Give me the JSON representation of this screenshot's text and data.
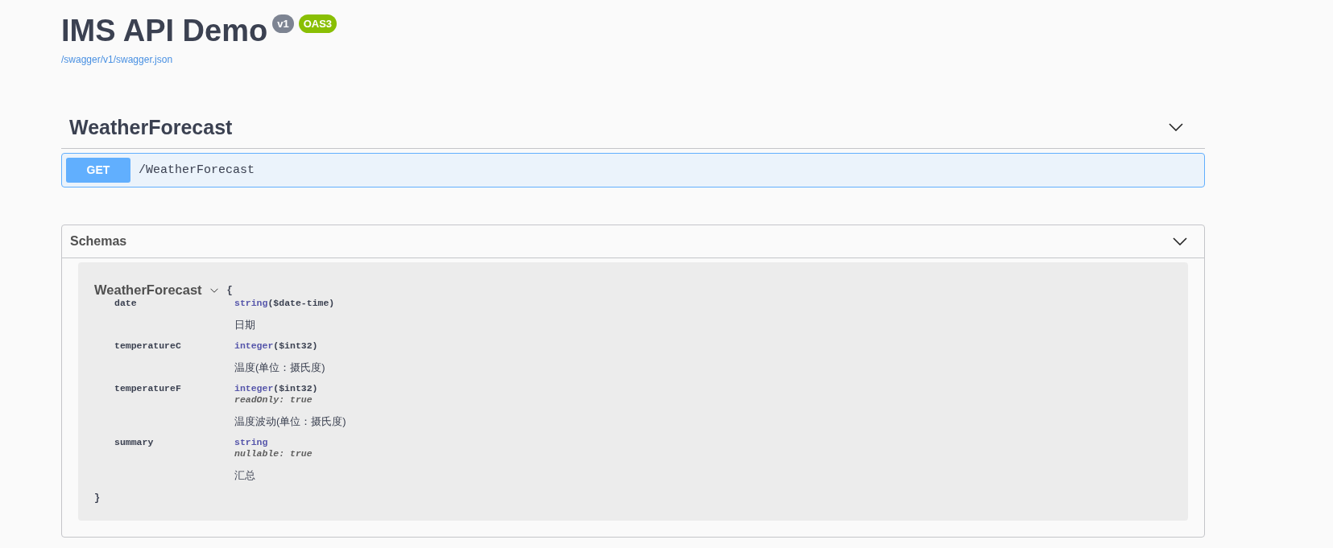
{
  "info": {
    "title": "IMS API Demo",
    "badges": [
      {
        "text": "v1",
        "color": "#7d8492"
      },
      {
        "text": "OAS3",
        "color": "#89bf04"
      }
    ],
    "spec_link": "/swagger/v1/swagger.json"
  },
  "tags": [
    {
      "name": "WeatherForecast",
      "expanded": true,
      "operations": [
        {
          "kind": "get",
          "method": "GET",
          "path": "/WeatherForecast"
        }
      ]
    }
  ],
  "schemas": {
    "title": "Schemas",
    "expanded": true,
    "models": [
      {
        "name": "WeatherForecast",
        "expanded": true,
        "open_brace": "{",
        "close_brace": "}",
        "properties": [
          {
            "name": "date",
            "type": "string",
            "format": "($date-time)",
            "description": "日期"
          },
          {
            "name": "temperatureC",
            "type": "integer",
            "format": "($int32)",
            "description": "温度(单位：摄氏度)"
          },
          {
            "name": "temperatureF",
            "type": "integer",
            "format": "($int32)",
            "flags": [
              "readOnly: true"
            ],
            "description": "温度波动(单位：摄氏度)"
          },
          {
            "name": "summary",
            "type": "string",
            "flags": [
              "nullable: true"
            ],
            "description": "汇总"
          }
        ]
      }
    ]
  }
}
